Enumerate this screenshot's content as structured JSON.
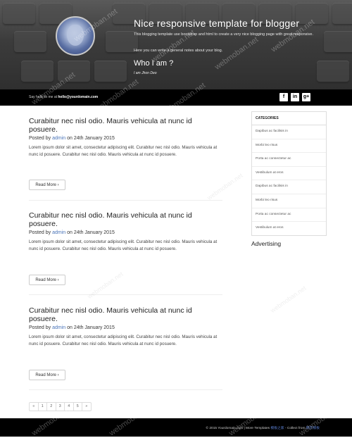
{
  "hero": {
    "title": "Nice responsive template for blogger",
    "desc1": "This blogging template use bootstrap and html to create a very nice blogging page with great responsive.",
    "desc2": "Here you can write a general notes about your blog.",
    "who_title": "Who I am ?",
    "author": "I am Jhon Deo"
  },
  "topbar": {
    "say_prefix": "Say hello to me at ",
    "email": "hello@yourdomain.com",
    "social": [
      {
        "icon": "facebook-icon",
        "glyph": "f"
      },
      {
        "icon": "linkedin-icon",
        "glyph": "in"
      },
      {
        "icon": "google-plus-icon",
        "glyph": "g+"
      }
    ]
  },
  "posts": [
    {
      "title": "Curabitur nec nisl odio. Mauris vehicula at nunc id posuere.",
      "posted_by": "Posted by",
      "author": "admin",
      "date": "on 24th January 2015",
      "excerpt": "Lorem ipsum dolor sit amet, consectetur adipiscing elit. Curabitur nec nisl odio. Mauris vehicula at nunc id posuere. Curabitur nec nisl odio. Mauris vehicula at nunc id posuere.",
      "read_more": "Read More ›"
    },
    {
      "title": "Curabitur nec nisl odio. Mauris vehicula at nunc id posuere.",
      "posted_by": "Posted by",
      "author": "admin",
      "date": "on 24th January 2015",
      "excerpt": "Lorem ipsum dolor sit amet, consectetur adipiscing elit. Curabitur nec nisl odio. Mauris vehicula at nunc id posuere. Curabitur nec nisl odio. Mauris vehicula at nunc id posuere.",
      "read_more": "Read More ›"
    },
    {
      "title": "Curabitur nec nisl odio. Mauris vehicula at nunc id posuere.",
      "posted_by": "Posted by",
      "author": "admin",
      "date": "on 24th January 2015",
      "excerpt": "Lorem ipsum dolor sit amet, consectetur adipiscing elit. Curabitur nec nisl odio. Mauris vehicula at nunc id posuere. Curabitur nec nisl odio. Mauris vehicula at nunc id posuere.",
      "read_more": "Read More ›"
    }
  ],
  "sidebar": {
    "heading": "CATEGORIES",
    "items": [
      "Dapibus ac facilisis in",
      "Morbi leo risus",
      "Porta ac consectetur ac",
      "Vestibulum at eros",
      "Dapibus ac facilisis in",
      "Morbi leo risus",
      "Porta ac consectetur ac",
      "Vestibulum at eros"
    ],
    "advertising": "Advertising"
  },
  "pagination": [
    "«",
    "1",
    "2",
    "3",
    "4",
    "5",
    "»"
  ],
  "footer": {
    "copy": "© 2015 Yourdomain.com | More Templates ",
    "link1": "模板之家",
    "mid": " - Collect from ",
    "link2": "网页模板"
  },
  "watermark": "webmoban.net"
}
